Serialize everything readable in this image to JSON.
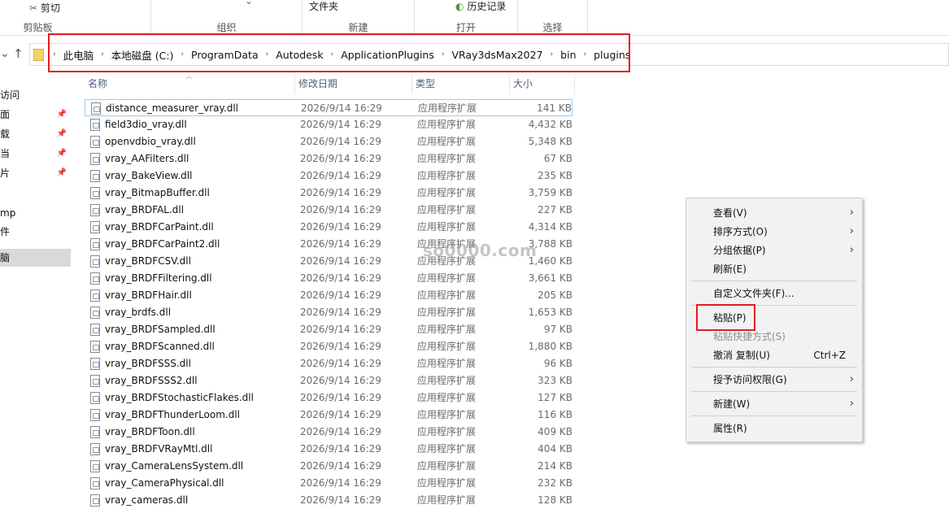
{
  "ribbon": {
    "cut_label": "剪切",
    "clipboard_group": "剪贴板",
    "organize_group": "组织",
    "new_folder_label": "文件夹",
    "new_group": "新建",
    "history_label": "历史记录",
    "open_group": "打开",
    "select_group": "选择"
  },
  "address": {
    "crumbs": [
      "此电脑",
      "本地磁盘 (C:)",
      "ProgramData",
      "Autodesk",
      "ApplicationPlugins",
      "VRay3dsMax2027",
      "bin",
      "plugins"
    ]
  },
  "nav": {
    "items": [
      "访问",
      "面",
      "载",
      "当",
      "片",
      "mp",
      "件",
      "脑"
    ]
  },
  "columns": {
    "name": "名称",
    "date": "修改日期",
    "type": "类型",
    "size": "大小"
  },
  "files": [
    {
      "name": "distance_measurer_vray.dll",
      "date": "2026/9/14 16:29",
      "type": "应用程序扩展",
      "size": "141 KB"
    },
    {
      "name": "field3dio_vray.dll",
      "date": "2026/9/14 16:29",
      "type": "应用程序扩展",
      "size": "4,432 KB"
    },
    {
      "name": "openvdbio_vray.dll",
      "date": "2026/9/14 16:29",
      "type": "应用程序扩展",
      "size": "5,348 KB"
    },
    {
      "name": "vray_AAFilters.dll",
      "date": "2026/9/14 16:29",
      "type": "应用程序扩展",
      "size": "67 KB"
    },
    {
      "name": "vray_BakeView.dll",
      "date": "2026/9/14 16:29",
      "type": "应用程序扩展",
      "size": "235 KB"
    },
    {
      "name": "vray_BitmapBuffer.dll",
      "date": "2026/9/14 16:29",
      "type": "应用程序扩展",
      "size": "3,759 KB"
    },
    {
      "name": "vray_BRDFAL.dll",
      "date": "2026/9/14 16:29",
      "type": "应用程序扩展",
      "size": "227 KB"
    },
    {
      "name": "vray_BRDFCarPaint.dll",
      "date": "2026/9/14 16:29",
      "type": "应用程序扩展",
      "size": "4,314 KB"
    },
    {
      "name": "vray_BRDFCarPaint2.dll",
      "date": "2026/9/14 16:29",
      "type": "应用程序扩展",
      "size": "3,788 KB"
    },
    {
      "name": "vray_BRDFCSV.dll",
      "date": "2026/9/14 16:29",
      "type": "应用程序扩展",
      "size": "1,460 KB"
    },
    {
      "name": "vray_BRDFFiltering.dll",
      "date": "2026/9/14 16:29",
      "type": "应用程序扩展",
      "size": "3,661 KB"
    },
    {
      "name": "vray_BRDFHair.dll",
      "date": "2026/9/14 16:29",
      "type": "应用程序扩展",
      "size": "205 KB"
    },
    {
      "name": "vray_brdfs.dll",
      "date": "2026/9/14 16:29",
      "type": "应用程序扩展",
      "size": "1,653 KB"
    },
    {
      "name": "vray_BRDFSampled.dll",
      "date": "2026/9/14 16:29",
      "type": "应用程序扩展",
      "size": "97 KB"
    },
    {
      "name": "vray_BRDFScanned.dll",
      "date": "2026/9/14 16:29",
      "type": "应用程序扩展",
      "size": "1,880 KB"
    },
    {
      "name": "vray_BRDFSSS.dll",
      "date": "2026/9/14 16:29",
      "type": "应用程序扩展",
      "size": "96 KB"
    },
    {
      "name": "vray_BRDFSSS2.dll",
      "date": "2026/9/14 16:29",
      "type": "应用程序扩展",
      "size": "323 KB"
    },
    {
      "name": "vray_BRDFStochasticFlakes.dll",
      "date": "2026/9/14 16:29",
      "type": "应用程序扩展",
      "size": "127 KB"
    },
    {
      "name": "vray_BRDFThunderLoom.dll",
      "date": "2026/9/14 16:29",
      "type": "应用程序扩展",
      "size": "116 KB"
    },
    {
      "name": "vray_BRDFToon.dll",
      "date": "2026/9/14 16:29",
      "type": "应用程序扩展",
      "size": "409 KB"
    },
    {
      "name": "vray_BRDFVRayMtl.dll",
      "date": "2026/9/14 16:29",
      "type": "应用程序扩展",
      "size": "404 KB"
    },
    {
      "name": "vray_CameraLensSystem.dll",
      "date": "2026/9/14 16:29",
      "type": "应用程序扩展",
      "size": "214 KB"
    },
    {
      "name": "vray_CameraPhysical.dll",
      "date": "2026/9/14 16:29",
      "type": "应用程序扩展",
      "size": "232 KB"
    },
    {
      "name": "vray_cameras.dll",
      "date": "2026/9/14 16:29",
      "type": "应用程序扩展",
      "size": "128 KB"
    }
  ],
  "watermark": "so0000.com",
  "context_menu": {
    "view": "查看(V)",
    "sort_by": "排序方式(O)",
    "group_by": "分组依据(P)",
    "refresh": "刷新(E)",
    "customize": "自定义文件夹(F)...",
    "paste": "粘贴(P)",
    "paste_shortcut": "粘贴快捷方式(S)",
    "undo_copy": "撤消 复制(U)",
    "undo_shortcut": "Ctrl+Z",
    "give_access": "授予访问权限(G)",
    "new": "新建(W)",
    "properties": "属性(R)"
  }
}
